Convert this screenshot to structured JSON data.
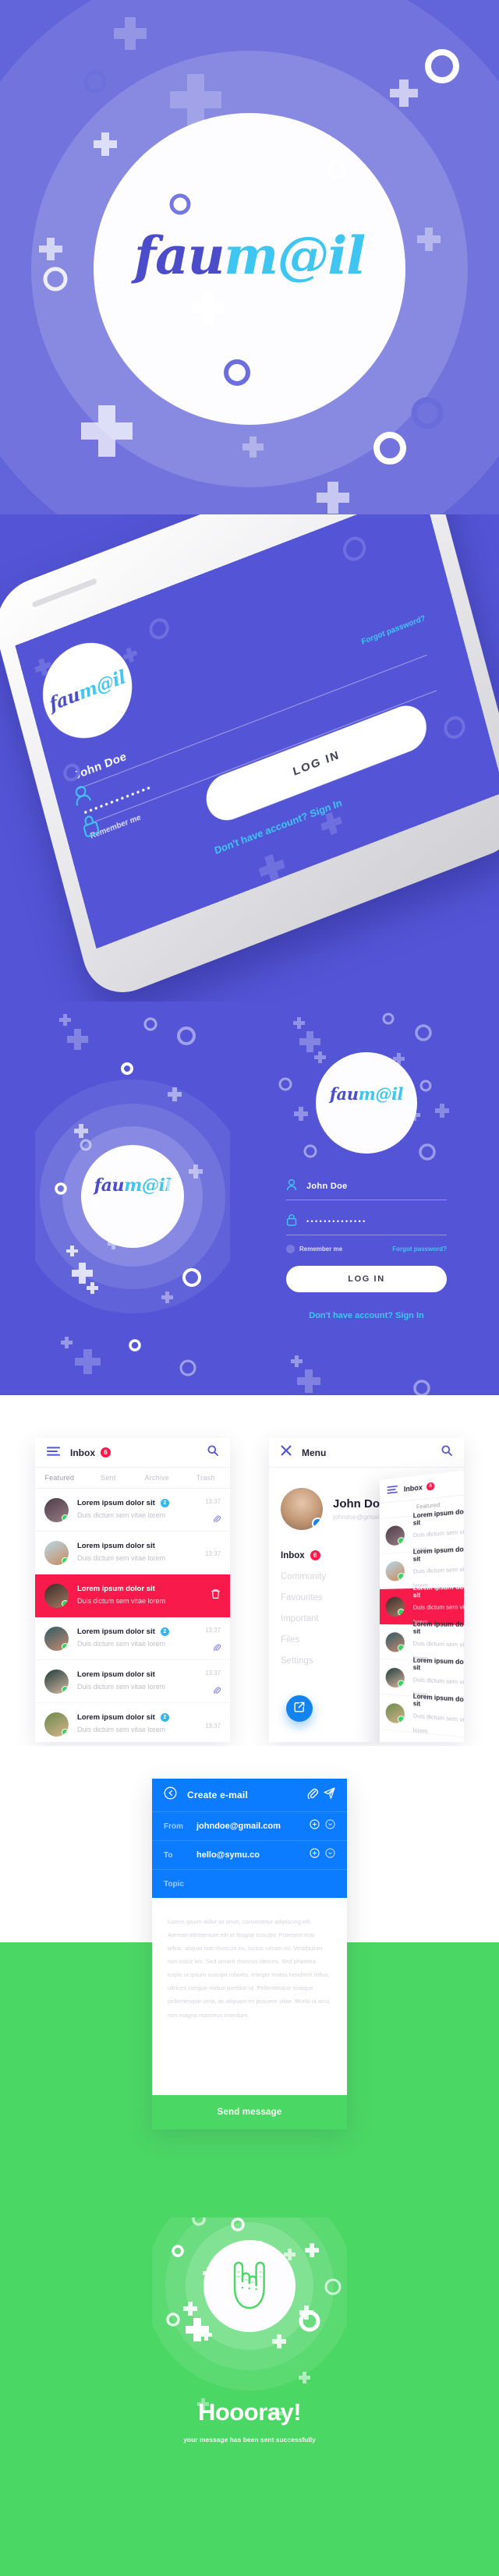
{
  "brand": {
    "logo_primary": "fau",
    "logo_secondary": "m@il",
    "color_purple": "#5355D6",
    "color_cyan": "#3FC6F0",
    "color_blue": "#0B7BFF",
    "color_green": "#4BD764",
    "color_red": "#F81A4B",
    "color_logo_dark": "#4A4CC9"
  },
  "hero": {
    "logo_primary": "fau",
    "logo_secondary": "m@il"
  },
  "phone_mockup": {
    "logo_primary": "fau",
    "logo_secondary": "m@il",
    "username_value": "John Doe",
    "password_value": "•••••••••••••",
    "remember_label": "Remember me",
    "forgot_label": "Forgot password?",
    "login_button": "LOG IN",
    "signup_prompt": "Don't have account?",
    "signup_link": "Sign In"
  },
  "splash_screen": {
    "logo_primary": "fau",
    "logo_secondary": "m@il"
  },
  "login_screen": {
    "logo_primary": "fau",
    "logo_secondary": "m@il",
    "username_value": "John Doe",
    "username_icon": "user-icon",
    "password_value": "••••••••••••••",
    "password_icon": "lock-icon",
    "remember_label": "Remember me",
    "forgot_label": "Forgot password?",
    "login_button": "LOG IN",
    "signup_prompt": "Don't have account?",
    "signup_link": "Sign In"
  },
  "inbox_screen": {
    "menu_icon": "hamburger-icon",
    "title": "Inbox",
    "badge": "6",
    "search_icon": "search-icon",
    "tabs": [
      {
        "label": "Featured",
        "active": true
      },
      {
        "label": "Sent",
        "active": false
      },
      {
        "label": "Archive",
        "active": false
      },
      {
        "label": "Trash",
        "active": false
      }
    ],
    "messages": [
      {
        "subject": "Lorem ipsum dolor sit",
        "preview": "Duis dictum sem vitae lorem",
        "time": "13:37",
        "count": "2",
        "has_attachment": true,
        "selected": false
      },
      {
        "subject": "Lorem ipsum dolor sit",
        "preview": "Duis dictum sem vitae lorem",
        "time": "13:37",
        "count": "",
        "has_attachment": false,
        "selected": false
      },
      {
        "subject": "Lorem ipsum dolor sit",
        "preview": "Duis dictum sem vitae lorem",
        "time": "",
        "count": "",
        "has_attachment": false,
        "selected": true
      },
      {
        "subject": "Lorem ipsum dolor sit",
        "preview": "Duis dictum sem vitae lorem",
        "time": "13:37",
        "count": "2",
        "has_attachment": true,
        "selected": false
      },
      {
        "subject": "Lorem ipsum dolor sit",
        "preview": "Duis dictum sem vitae lorem",
        "time": "13:37",
        "count": "",
        "has_attachment": true,
        "selected": false
      },
      {
        "subject": "Lorem ipsum dolor sit",
        "preview": "Duis dictum sem vitae lorem",
        "time": "13:37",
        "count": "2",
        "has_attachment": false,
        "selected": false
      }
    ],
    "delete_icon": "trash-icon"
  },
  "menu_screen": {
    "close_icon": "close-icon",
    "title": "Menu",
    "search_icon": "search-icon",
    "profile_name": "John Doe",
    "profile_email": "johndoe@gmail.com",
    "verified_icon": "verified-badge-icon",
    "nav": [
      {
        "label": "Inbox",
        "badge": "6",
        "active": true
      },
      {
        "label": "Community",
        "badge": "",
        "active": false
      },
      {
        "label": "Favourites",
        "badge": "",
        "active": false
      },
      {
        "label": "Important",
        "badge": "",
        "active": false
      },
      {
        "label": "Files",
        "badge": "",
        "active": false
      },
      {
        "label": "Settings",
        "badge": "",
        "active": false
      }
    ],
    "compose_fab_icon": "compose-icon"
  },
  "compose_screen": {
    "back_icon": "back-arrow-circle-icon",
    "title": "Create e-mail",
    "attach_icon": "paperclip-icon",
    "send_icon": "paper-plane-icon",
    "from_label": "From",
    "from_value": "johndoe@gmail.com",
    "to_label": "To",
    "to_value": "hello@symu.co",
    "topic_label": "Topic",
    "topic_value": "",
    "add_icon": "plus-circle-icon",
    "expand_icon": "chevron-down-circle-icon",
    "body_text": "Lorem ipsum dolor sit amet, consectetur adipiscing elit. Aenean elementum elit et feugiat suscipit. Praesent erat tellus, aliquat non rhoncus eu, luctus rutrum mi. Vestibulum non tortor leo. Sed ornare rhoncus ultrices. Sed pharetra turpis ut ipsum suscipit lobortis. Integer mattis hendrerit tellus, ultrices congue metus porttitor ut. Pellentesque tristique pellentesque urna, ac aliquam mi posuere vitae. Morbi ut arcu non magna maximus interdum.",
    "send_button": "Send message"
  },
  "success_screen": {
    "icon": "rock-hand-icon",
    "title": "Hoooray!",
    "subtitle": "your message has been sent successfully"
  }
}
